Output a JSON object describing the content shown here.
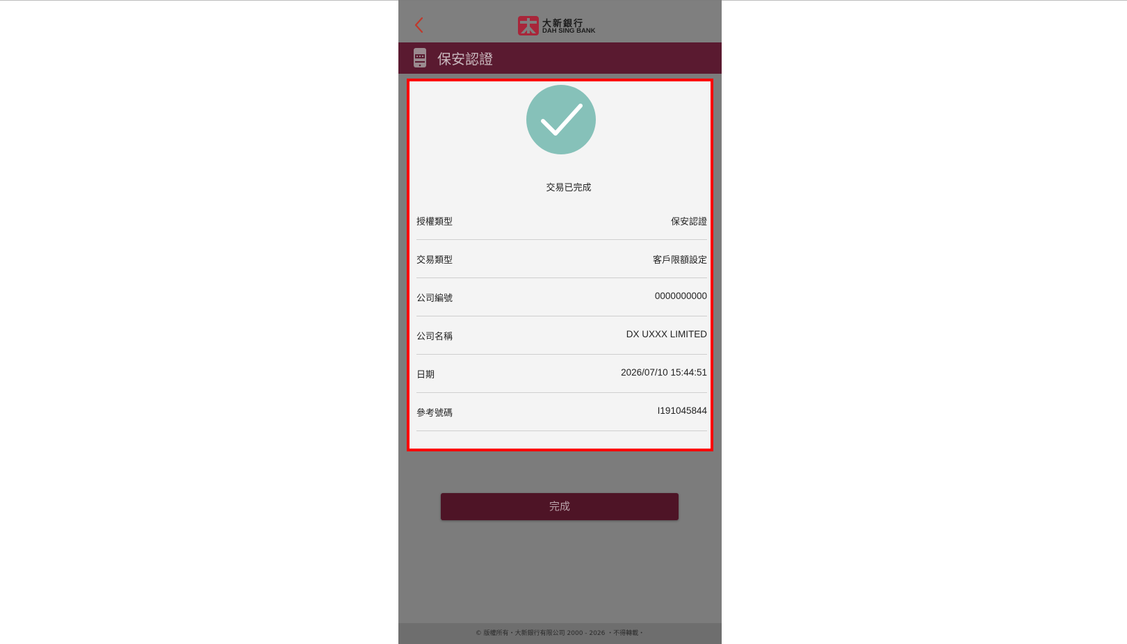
{
  "header": {
    "logo_cn": "大新銀行",
    "logo_en": "DAH SING BANK",
    "back_icon": "chevron-left-icon",
    "accent_color": "#c0392b"
  },
  "title_bar": {
    "title": "保安認證",
    "icon": "security-token-icon",
    "bg_color": "#5a1a30"
  },
  "result": {
    "icon": "check-icon",
    "icon_color": "#86c1b9",
    "status": "交易已完成"
  },
  "details": [
    {
      "label": "授權類型",
      "value": "保安認證"
    },
    {
      "label": "交易類型",
      "value": "客戶限額設定"
    },
    {
      "label": "公司編號",
      "value": "0000000000"
    },
    {
      "label": "公司名稱",
      "value": "DX UXXX LIMITED"
    },
    {
      "label": "日期",
      "value": "2026/07/10 15:44:51"
    },
    {
      "label": "參考號碼",
      "value": "I191045844"
    }
  ],
  "actions": {
    "done_label": "完成"
  },
  "footer": {
    "text": "© 版權所有・大新銀行有限公司 2000 - 2026 ・不得轉載・"
  }
}
